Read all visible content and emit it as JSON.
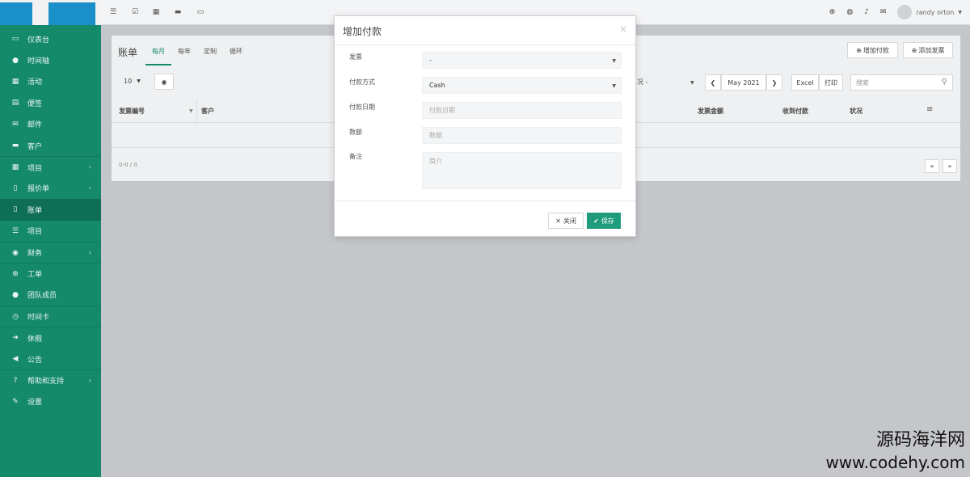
{
  "sidebar": {
    "items": [
      {
        "label": "仪表台",
        "icon": "monitor-icon",
        "glyph": "▭"
      },
      {
        "label": "时间轴",
        "icon": "chat-icon",
        "glyph": "●"
      },
      {
        "label": "活动",
        "icon": "calendar-icon",
        "glyph": "▦"
      },
      {
        "label": "便签",
        "icon": "note-icon",
        "glyph": "▤"
      },
      {
        "label": "邮件",
        "icon": "mail-icon",
        "glyph": "✉"
      },
      {
        "label": "客户",
        "icon": "briefcase-icon",
        "glyph": "▬"
      },
      {
        "label": "项目",
        "icon": "grid-icon",
        "glyph": "▦"
      },
      {
        "label": "报价单",
        "icon": "file-icon",
        "glyph": "▯"
      },
      {
        "label": "账单",
        "icon": "file-icon",
        "glyph": "▯"
      },
      {
        "label": "项目",
        "icon": "list-icon",
        "glyph": "☰"
      },
      {
        "label": "财务",
        "icon": "money-icon",
        "glyph": "◉"
      },
      {
        "label": "工单",
        "icon": "lifebuoy-icon",
        "glyph": "⊕"
      },
      {
        "label": "团队成员",
        "icon": "user-icon",
        "glyph": "●"
      },
      {
        "label": "时间卡",
        "icon": "clock-icon",
        "glyph": "◷"
      },
      {
        "label": "休假",
        "icon": "signout-icon",
        "glyph": "➜"
      },
      {
        "label": "公告",
        "icon": "bullhorn-icon",
        "glyph": "◀"
      },
      {
        "label": "帮助和支持",
        "icon": "question-icon",
        "glyph": "?"
      },
      {
        "label": "设置",
        "icon": "wrench-icon",
        "glyph": "✎"
      }
    ]
  },
  "topbar": {
    "username": "randy orton"
  },
  "page": {
    "title": "账单",
    "tabs": [
      "每月",
      "每年",
      "定制",
      "循环"
    ],
    "add_payment": "增加付款",
    "add_invoice": "添加发票",
    "page_size": "10",
    "status_filter": "况 -",
    "month": "May 2021",
    "excel": "Excel",
    "print": "打印",
    "search_placeholder": "搜索",
    "columns": [
      "发票编号",
      "客户",
      "发票金额",
      "收到付款",
      "状况"
    ],
    "count": "0-0 / 0"
  },
  "modal": {
    "title": "增加付款",
    "close_x": "×",
    "invoice_label": "发票",
    "invoice_value": "-",
    "method_label": "付款方式",
    "method_value": "Cash",
    "date_label": "付款日期",
    "date_placeholder": "付款日期",
    "amount_label": "数额",
    "amount_placeholder": "数额",
    "note_label": "备注",
    "note_placeholder": "简介",
    "close_button": "关闭",
    "save_button": "保存"
  },
  "watermark": {
    "line1": "源码海洋网",
    "line2": "www.codehy.com"
  }
}
